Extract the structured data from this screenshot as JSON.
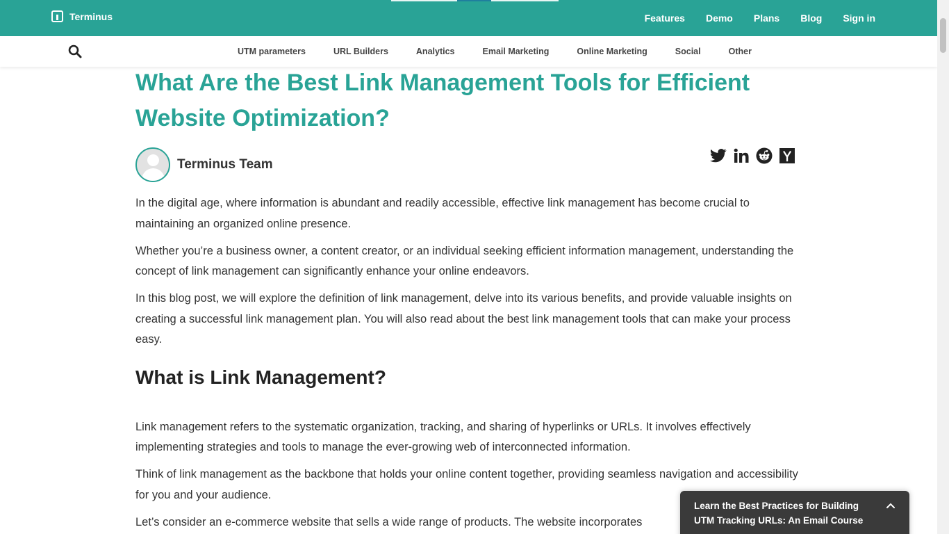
{
  "header": {
    "logo_text": "Terminus",
    "nav": [
      "Features",
      "Demo",
      "Plans",
      "Blog",
      "Sign in"
    ],
    "color": "#29a396"
  },
  "subnav": {
    "search_icon": "search-icon",
    "items": [
      "UTM parameters",
      "URL Builders",
      "Analytics",
      "Email Marketing",
      "Online Marketing",
      "Social",
      "Other"
    ]
  },
  "article": {
    "title": "What Are the Best Link Management Tools for Efficient Website Optimization?",
    "author": "Terminus Team",
    "share_icons": [
      "twitter-icon",
      "linkedin-icon",
      "reddit-icon",
      "hacker-news-icon"
    ],
    "intro": [
      "In the digital age, where information is abundant and readily accessible, effective link management has become crucial to maintaining an organized online presence.",
      "Whether you’re a business owner, a content creator, or an individual seeking efficient information management, understanding the concept of link management can significantly enhance your online endeavors.",
      "In this blog post, we will explore the definition of link management, delve into its various benefits, and provide valuable insights on creating a successful link management plan. You will also read about the best link management tools that can make your process easy."
    ],
    "section_heading": "What is Link Management?",
    "section_paras": [
      "Link management refers to the systematic organization, tracking, and sharing of hyperlinks or URLs. It involves effectively implementing strategies and tools to manage the ever-growing web of interconnected information.",
      "Think of link management as the backbone that holds your online content together, providing seamless navigation and accessibility for you and your audience.",
      "Let’s consider an e-commerce website that sells a wide range of products. The website incorporates"
    ]
  },
  "course_popup": {
    "text": "Learn the Best Practices for Building UTM Tracking URLs: An Email Course",
    "toggle_icon": "chevron-up-icon"
  }
}
